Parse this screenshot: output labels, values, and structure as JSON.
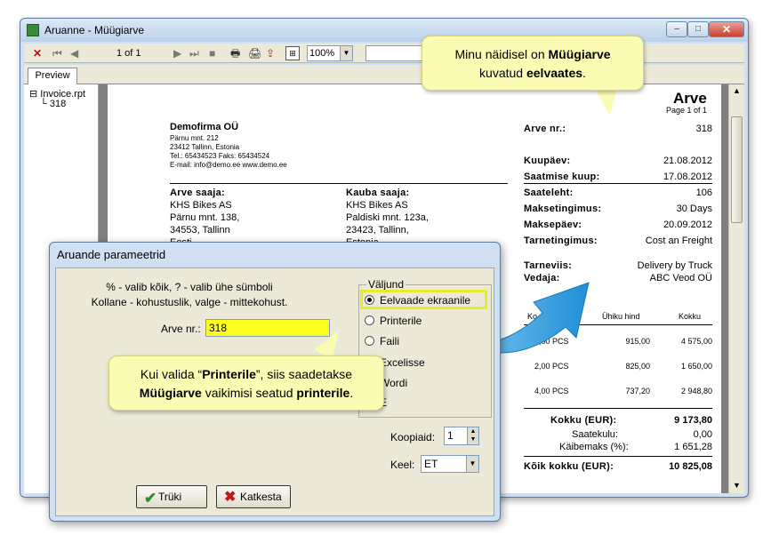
{
  "window": {
    "title": "Aruanne - Müügiarve",
    "min_glyph": "–",
    "max_glyph": "□",
    "close_glyph": "✕"
  },
  "toolbar": {
    "close_glyph": "✕",
    "first_glyph": "⏮",
    "prev_glyph": "◀",
    "page_indicator": "1 of 1",
    "next_glyph": "▶",
    "last_glyph": "⏭",
    "stop_glyph": "■",
    "print_glyph": "🖶",
    "print_setup_glyph": "🖨",
    "export_glyph": "⇪",
    "tree_glyph": "⊞",
    "zoom": "100%"
  },
  "tabs": {
    "preview": "Preview"
  },
  "tree": {
    "root": "⊟ Invoice.rpt",
    "child": "318"
  },
  "report": {
    "doc_title": "Arve",
    "page_of": "Page 1 of 1",
    "company_name": "Demofirma OÜ",
    "company_street": "Pärnu mnt. 212",
    "company_city": "23412 Tallinn, Estonia",
    "company_phone": "Tel.: 65434523      Faks: 65434524",
    "company_email": "E-mail: info@demo.ee          www.demo.ee",
    "invoice_no_label": "Arve nr.:",
    "invoice_no": "318",
    "date_label": "Kuupäev:",
    "date": "21.08.2012",
    "shipping_date_label": "Saatmise kuup:",
    "shipping_date": "17.08.2012",
    "buyer_label": "Arve saaja:",
    "buyer_name": "KHS Bikes AS",
    "buyer_street": "Pärnu mnt. 138,",
    "buyer_city": "34553, Tallinn",
    "buyer_country": "Eesti",
    "recipient_label": "Kauba saaja:",
    "recipient_name": "KHS Bikes AS",
    "recipient_street": "Paldiski mnt. 123a,",
    "recipient_city": "23423, Tallinn,",
    "recipient_country": "Estonia",
    "waybill_label": "Saateleht:",
    "waybill": "106",
    "payment_term_label": "Maksetingimus:",
    "payment_term": "30 Days",
    "due_date_label": "Maksepäev:",
    "due_date": "20.09.2012",
    "delivery_term_label": "Tarnetingimus:",
    "delivery_term": "Cost an Freight",
    "delivery_method_label": "Tarneviis:",
    "delivery_method": "Delivery by Truck",
    "carrier_label": "Vedaja:",
    "carrier": "ABC Veod OÜ",
    "col_qty": "Ko",
    "col_unit_price": "Ühiku hind",
    "col_total": "Kokku",
    "rows": [
      {
        "qty": "5,00 PCS",
        "price": "915,00",
        "total": "4 575,00"
      },
      {
        "qty": "2,00 PCS",
        "price": "825,00",
        "total": "1 650,00"
      },
      {
        "qty": "4,00 PCS",
        "price": "737,20",
        "total": "2 948,80"
      }
    ],
    "sum_label": "Kokku (EUR):",
    "sum": "9 173,80",
    "shipping_cost_label": "Saatekulu:",
    "shipping_cost": "0,00",
    "vat_label": "Käibemaks (%):",
    "vat": "1 651,28",
    "grand_total_label": "Kõik kokku (EUR):",
    "grand_total": "10 825,08"
  },
  "dialog": {
    "title": "Aruande parameetrid",
    "hint_1": "% - valib kõik, ? - valib ühe sümboli",
    "hint_2": "Kollane - kohustuslik, valge - mittekohust.",
    "invoice_label": "Arve nr.:",
    "invoice_value": "318",
    "output_legend": "Väljund",
    "output_options": [
      "Eelvaade ekraanile",
      "Printerile",
      "Faili",
      "Excelisse",
      "Wordi",
      "E"
    ],
    "copies_label": "Koopiaid:",
    "copies_value": "1",
    "language_label": "Keel:",
    "language_value": "ET",
    "print_label": "Trüki",
    "cancel_label": "Katkesta"
  },
  "callouts": {
    "top_pre": "Minu näidisel on ",
    "top_bold1": "Müügiarve",
    "top_mid": "kuvatud ",
    "top_bold2": "eelvaates",
    "top_end": ".",
    "bottom_pre": "Kui valida “",
    "bottom_bold1": "Printerile",
    "bottom_mid": "”, siis saadetakse",
    "bottom_bold2": "Müügiarve",
    "bottom_mid2": " vaikimisi seatud ",
    "bottom_bold3": "printerile",
    "bottom_end": "."
  }
}
